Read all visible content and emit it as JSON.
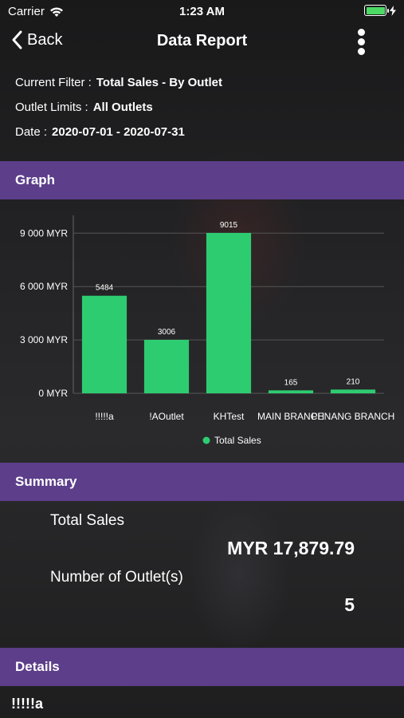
{
  "status_bar": {
    "carrier": "Carrier",
    "time": "1:23 AM"
  },
  "nav": {
    "back_label": "Back",
    "title": "Data Report"
  },
  "filters": {
    "current_filter_label": "Current Filter :",
    "current_filter_value": "Total Sales - By Outlet",
    "outlet_limits_label": "Outlet Limits :",
    "outlet_limits_value": "All Outlets",
    "date_label": "Date :",
    "date_value": "2020-07-01 - 2020-07-31"
  },
  "sections": {
    "graph": "Graph",
    "summary": "Summary",
    "details": "Details"
  },
  "chart_data": {
    "type": "bar",
    "categories": [
      "!!!!!a",
      "!AOutlet",
      "KHTest",
      "MAIN BRANCH",
      "PENANG BRANCH"
    ],
    "series": [
      {
        "name": "Total Sales",
        "values": [
          5484,
          3006,
          9015,
          165,
          210
        ],
        "color": "#2ecc71"
      }
    ],
    "ylim": [
      0,
      10000
    ],
    "yticks": [
      0,
      3000,
      6000,
      9000
    ],
    "ytick_labels": [
      "0 MYR",
      "3 000 MYR",
      "6 000 MYR",
      "9 000 MYR"
    ],
    "grid": true,
    "legend": "bottom"
  },
  "summary": {
    "total_sales_label": "Total Sales",
    "total_sales_value": "MYR 17,879.79",
    "outlet_count_label": "Number of Outlet(s)",
    "outlet_count_value": "5"
  },
  "details": {
    "first_item": "!!!!!a"
  }
}
